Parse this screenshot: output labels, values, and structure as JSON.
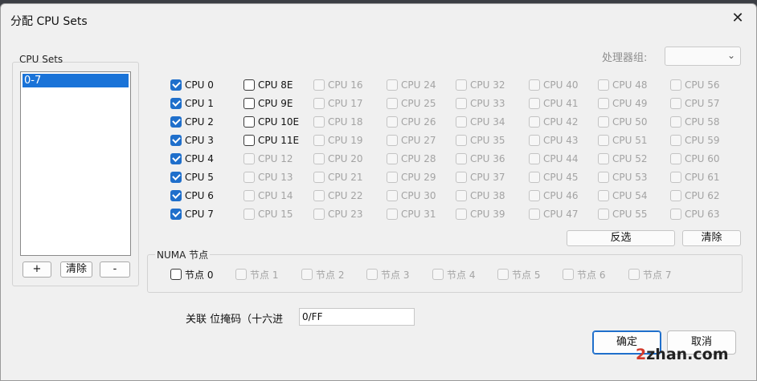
{
  "title": "分配 CPU Sets",
  "close_glyph": "✕",
  "cpu_sets_panel": {
    "label": "CPU Sets",
    "items": [
      "0-7"
    ],
    "add_label": "+",
    "clear_label": "清除",
    "remove_label": "-"
  },
  "processor_group": {
    "label": "处理器组:",
    "value": ""
  },
  "cpus": [
    {
      "label": "CPU 0",
      "state": "checked"
    },
    {
      "label": "CPU 1",
      "state": "checked"
    },
    {
      "label": "CPU 2",
      "state": "checked"
    },
    {
      "label": "CPU 3",
      "state": "checked"
    },
    {
      "label": "CPU 4",
      "state": "checked"
    },
    {
      "label": "CPU 5",
      "state": "checked"
    },
    {
      "label": "CPU 6",
      "state": "checked"
    },
    {
      "label": "CPU 7",
      "state": "checked"
    },
    {
      "label": "CPU 8E",
      "state": "enabled"
    },
    {
      "label": "CPU 9E",
      "state": "enabled"
    },
    {
      "label": "CPU 10E",
      "state": "enabled"
    },
    {
      "label": "CPU 11E",
      "state": "enabled"
    },
    {
      "label": "CPU 12",
      "state": "disabled"
    },
    {
      "label": "CPU 13",
      "state": "disabled"
    },
    {
      "label": "CPU 14",
      "state": "disabled"
    },
    {
      "label": "CPU 15",
      "state": "disabled"
    },
    {
      "label": "CPU 16",
      "state": "disabled"
    },
    {
      "label": "CPU 17",
      "state": "disabled"
    },
    {
      "label": "CPU 18",
      "state": "disabled"
    },
    {
      "label": "CPU 19",
      "state": "disabled"
    },
    {
      "label": "CPU 20",
      "state": "disabled"
    },
    {
      "label": "CPU 21",
      "state": "disabled"
    },
    {
      "label": "CPU 22",
      "state": "disabled"
    },
    {
      "label": "CPU 23",
      "state": "disabled"
    },
    {
      "label": "CPU 24",
      "state": "disabled"
    },
    {
      "label": "CPU 25",
      "state": "disabled"
    },
    {
      "label": "CPU 26",
      "state": "disabled"
    },
    {
      "label": "CPU 27",
      "state": "disabled"
    },
    {
      "label": "CPU 28",
      "state": "disabled"
    },
    {
      "label": "CPU 29",
      "state": "disabled"
    },
    {
      "label": "CPU 30",
      "state": "disabled"
    },
    {
      "label": "CPU 31",
      "state": "disabled"
    },
    {
      "label": "CPU 32",
      "state": "disabled"
    },
    {
      "label": "CPU 33",
      "state": "disabled"
    },
    {
      "label": "CPU 34",
      "state": "disabled"
    },
    {
      "label": "CPU 35",
      "state": "disabled"
    },
    {
      "label": "CPU 36",
      "state": "disabled"
    },
    {
      "label": "CPU 37",
      "state": "disabled"
    },
    {
      "label": "CPU 38",
      "state": "disabled"
    },
    {
      "label": "CPU 39",
      "state": "disabled"
    },
    {
      "label": "CPU 40",
      "state": "disabled"
    },
    {
      "label": "CPU 41",
      "state": "disabled"
    },
    {
      "label": "CPU 42",
      "state": "disabled"
    },
    {
      "label": "CPU 43",
      "state": "disabled"
    },
    {
      "label": "CPU 44",
      "state": "disabled"
    },
    {
      "label": "CPU 45",
      "state": "disabled"
    },
    {
      "label": "CPU 46",
      "state": "disabled"
    },
    {
      "label": "CPU 47",
      "state": "disabled"
    },
    {
      "label": "CPU 48",
      "state": "disabled"
    },
    {
      "label": "CPU 49",
      "state": "disabled"
    },
    {
      "label": "CPU 50",
      "state": "disabled"
    },
    {
      "label": "CPU 51",
      "state": "disabled"
    },
    {
      "label": "CPU 52",
      "state": "disabled"
    },
    {
      "label": "CPU 53",
      "state": "disabled"
    },
    {
      "label": "CPU 54",
      "state": "disabled"
    },
    {
      "label": "CPU 55",
      "state": "disabled"
    },
    {
      "label": "CPU 56",
      "state": "disabled"
    },
    {
      "label": "CPU 57",
      "state": "disabled"
    },
    {
      "label": "CPU 58",
      "state": "disabled"
    },
    {
      "label": "CPU 59",
      "state": "disabled"
    },
    {
      "label": "CPU 60",
      "state": "disabled"
    },
    {
      "label": "CPU 61",
      "state": "disabled"
    },
    {
      "label": "CPU 62",
      "state": "disabled"
    },
    {
      "label": "CPU 63",
      "state": "disabled"
    }
  ],
  "invert_label": "反选",
  "clear_all_label": "清除",
  "numa": {
    "title": "NUMA 节点",
    "nodes": [
      {
        "label": "节点 0",
        "state": "enabled"
      },
      {
        "label": "节点 1",
        "state": "disabled"
      },
      {
        "label": "节点 2",
        "state": "disabled"
      },
      {
        "label": "节点 3",
        "state": "disabled"
      },
      {
        "label": "节点 4",
        "state": "disabled"
      },
      {
        "label": "节点 5",
        "state": "disabled"
      },
      {
        "label": "节点 6",
        "state": "disabled"
      },
      {
        "label": "节点 7",
        "state": "disabled"
      }
    ]
  },
  "affinity_mask": {
    "label": "关联 位掩码（十六进",
    "value": "0/FF"
  },
  "ok_label": "确定",
  "cancel_label": "取消",
  "watermark": {
    "prefix": "2",
    "rest": "zhan.com"
  }
}
